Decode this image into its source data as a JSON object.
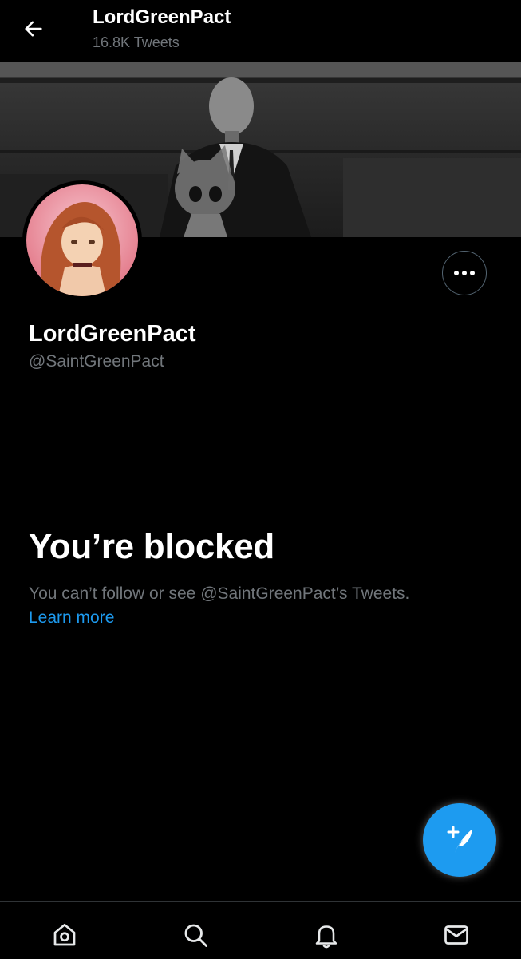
{
  "header": {
    "title": "LordGreenPact",
    "subtitle": "16.8K Tweets",
    "back_icon": "arrow-left-icon"
  },
  "profile": {
    "display_name": "LordGreenPact",
    "handle": "@SaintGreenPact",
    "more_icon": "more-horizontal-icon"
  },
  "blocked": {
    "title": "You’re blocked",
    "message": "You can’t follow or see @SaintGreenPact’s Tweets.",
    "link": "Learn more"
  },
  "fab": {
    "icon": "compose-tweet-icon"
  },
  "bottom_nav": {
    "items": [
      "home-icon",
      "search-icon",
      "notifications-icon",
      "messages-icon"
    ]
  },
  "colors": {
    "background": "#000000",
    "accent": "#1d9bf0",
    "secondary_text": "#71767b"
  }
}
